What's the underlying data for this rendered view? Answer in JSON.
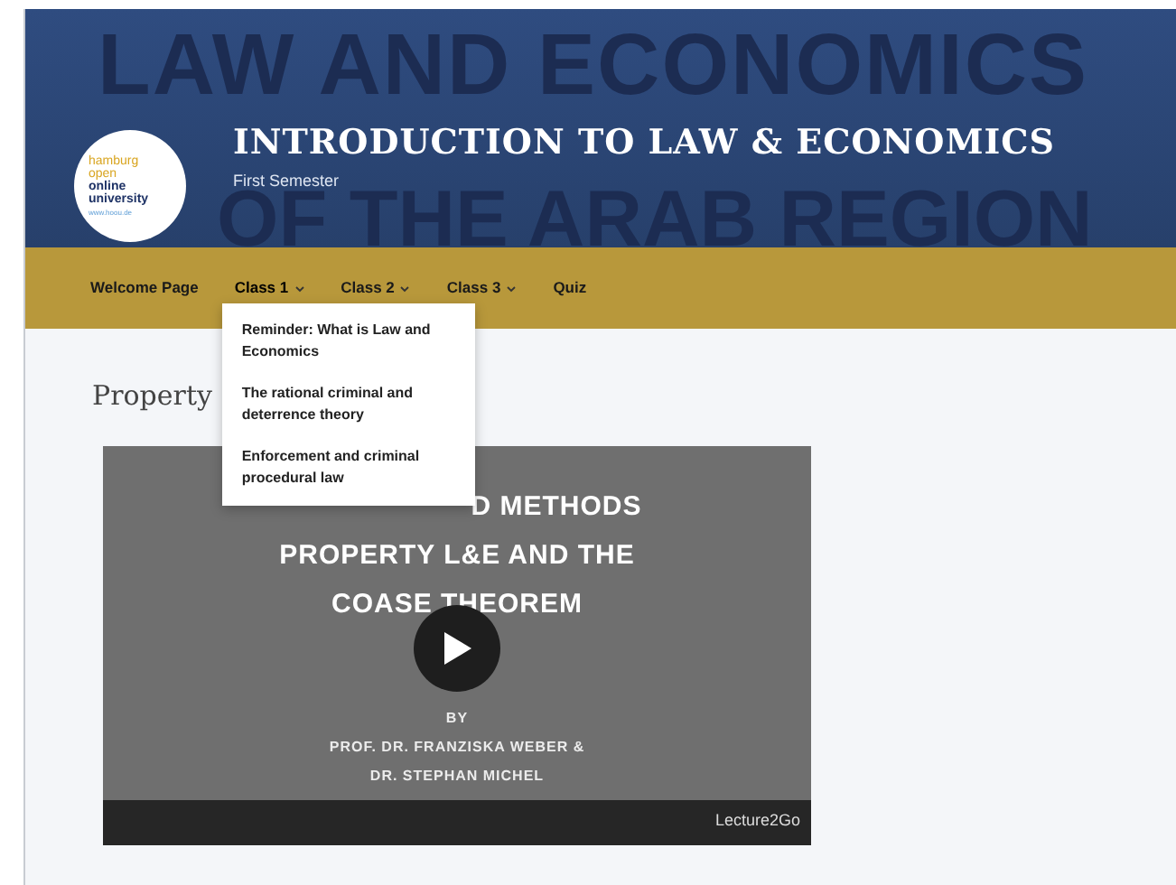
{
  "banner": {
    "backdrop_lines": [
      "LAW AND ECONOMICS",
      "OF THE ARAB REGION"
    ],
    "logo_lines": [
      "hamburg",
      "open",
      "online",
      "university",
      "www.hoou.de"
    ],
    "title": "INTRODUCTION TO LAW & ECONOMICS",
    "subtitle": "First Semester"
  },
  "nav": {
    "items": [
      {
        "label": "Welcome Page",
        "dropdown": false,
        "expanded": false
      },
      {
        "label": "Class 1",
        "dropdown": true,
        "expanded": true
      },
      {
        "label": "Class 2",
        "dropdown": true,
        "expanded": false
      },
      {
        "label": "Class 3",
        "dropdown": true,
        "expanded": false
      },
      {
        "label": "Quiz",
        "dropdown": false,
        "expanded": false
      }
    ],
    "menu": [
      "Reminder: What is Law and Economics",
      "The rational criminal and deterrence theory",
      "Enforcement and criminal procedural law"
    ]
  },
  "page_title": "Property",
  "video": {
    "title_lines": [
      "D METHODS",
      "PROPERTY L&E AND THE",
      "COASE THEOREM"
    ],
    "by": "BY",
    "authors": [
      "PROF. DR. FRANZISKA WEBER &",
      "DR. STEPHAN MICHEL"
    ],
    "brand": "Lecture2Go"
  }
}
